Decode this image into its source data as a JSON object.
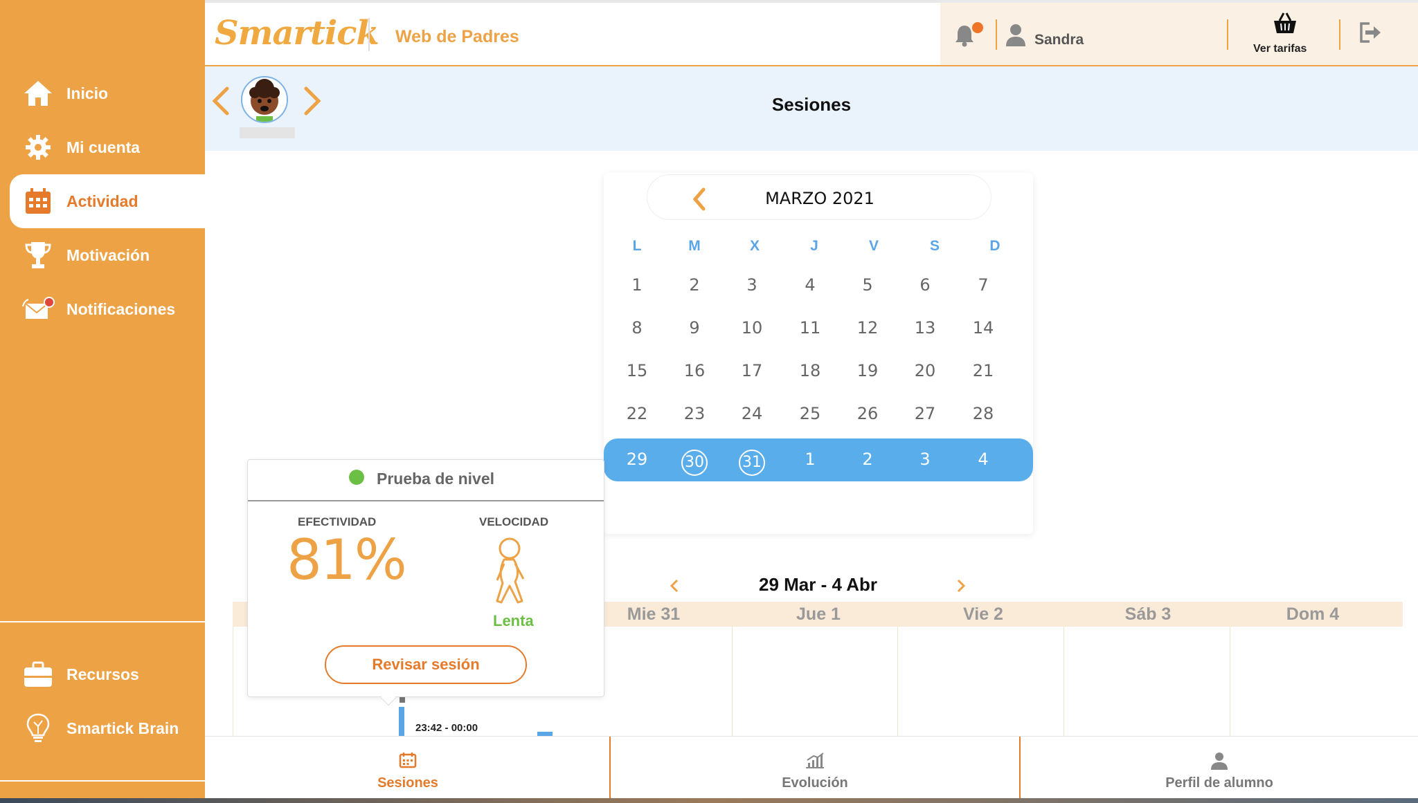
{
  "sidebar": {
    "items": [
      {
        "label": "Inicio",
        "icon": "home-icon"
      },
      {
        "label": "Mi cuenta",
        "icon": "gear-icon"
      },
      {
        "label": "Actividad",
        "icon": "calendar-icon",
        "active": true
      },
      {
        "label": "Motivación",
        "icon": "trophy-icon"
      },
      {
        "label": "Notificaciones",
        "icon": "mail-icon"
      }
    ],
    "bottom_items": [
      {
        "label": "Recursos",
        "icon": "briefcase-icon"
      },
      {
        "label": "Smartick Brain",
        "icon": "lightbulb-icon"
      }
    ]
  },
  "header": {
    "logo": "Smartick",
    "title": "Web de Padres",
    "user_name": "Sandra",
    "tarifas_label": "Ver tarifas"
  },
  "subheader": {
    "title": "Sesiones"
  },
  "calendar": {
    "month": "MARZO 2021",
    "weekdays": [
      "L",
      "M",
      "X",
      "J",
      "V",
      "S",
      "D"
    ],
    "weeks": [
      [
        "1",
        "2",
        "3",
        "4",
        "5",
        "6",
        "7"
      ],
      [
        "8",
        "9",
        "10",
        "11",
        "12",
        "13",
        "14"
      ],
      [
        "15",
        "16",
        "17",
        "18",
        "19",
        "20",
        "21"
      ],
      [
        "22",
        "23",
        "24",
        "25",
        "26",
        "27",
        "28"
      ],
      [
        "29",
        "30",
        "31",
        "1",
        "2",
        "3",
        "4"
      ]
    ],
    "selected_week_index": 4,
    "circled_days": [
      "30",
      "31"
    ]
  },
  "week": {
    "range": "29 Mar - 4 Abr",
    "days": [
      "Mie 31",
      "Jue 1",
      "Vie 2",
      "Sáb 3",
      "Dom 4"
    ],
    "event_time": "23:42 - 00:00"
  },
  "popup": {
    "title": "Prueba de nivel",
    "effectiveness_label": "EFECTIVIDAD",
    "effectiveness_value": "81%",
    "speed_label": "VELOCIDAD",
    "speed_value": "Lenta",
    "review_button": "Revisar sesión"
  },
  "tabs": [
    {
      "label": "Sesiones",
      "icon": "calendar-icon",
      "active": true
    },
    {
      "label": "Evolución",
      "icon": "bar-chart-icon"
    },
    {
      "label": "Perfil de alumno",
      "icon": "person-icon"
    }
  ],
  "colors": {
    "sidebar": "#EDA246",
    "accent": "#E57A2B",
    "blue": "#5AADEB",
    "green": "#6CBF45"
  }
}
